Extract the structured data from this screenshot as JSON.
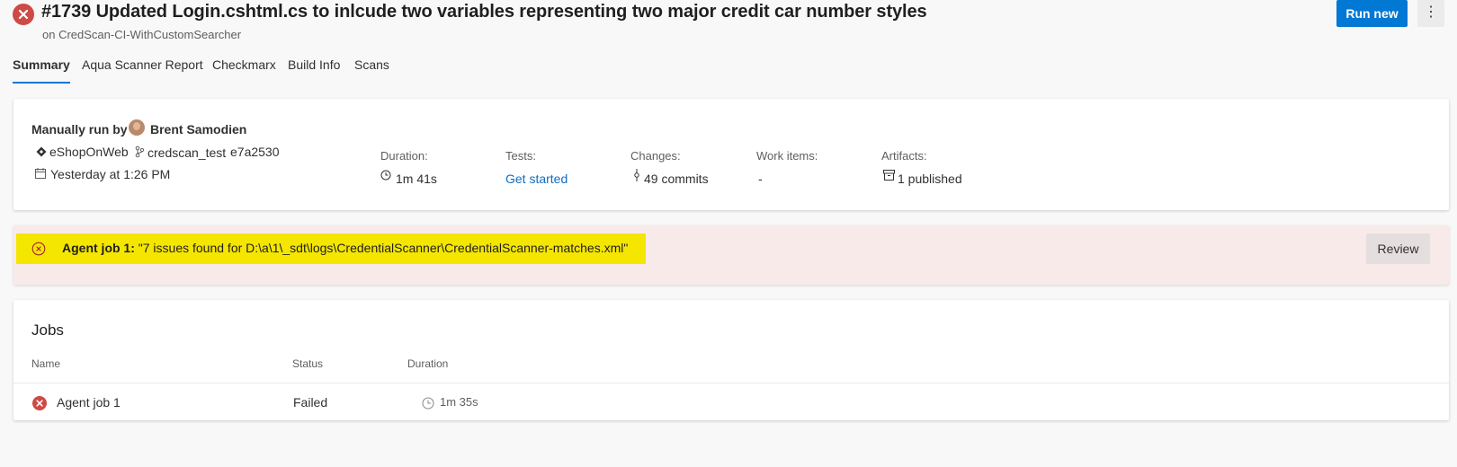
{
  "header": {
    "title": "#1739 Updated Login.cshtml.cs to inlcude two variables representing two major credit car number styles",
    "subtitle": "on CredScan-CI-WithCustomSearcher",
    "run_new_label": "Run new",
    "more_label": "⋮",
    "status_color": "#cd4a45"
  },
  "tabs": [
    {
      "label": "Summary",
      "active": true
    },
    {
      "label": "Aqua Scanner Report",
      "active": false
    },
    {
      "label": "Checkmarx",
      "active": false
    },
    {
      "label": "Build Info",
      "active": false
    },
    {
      "label": "Scans",
      "active": false
    }
  ],
  "summary": {
    "run_by_label": "Manually run by",
    "runner_name": "Brent Samodien",
    "repo": "eShopOnWeb",
    "branch": "credscan_test",
    "commit": "e7a2530",
    "date": "Yesterday at 1:26 PM",
    "duration_label": "Duration:",
    "duration_value": "1m 41s",
    "tests_label": "Tests:",
    "tests_value": "Get started",
    "changes_label": "Changes:",
    "changes_value": "49 commits",
    "work_items_label": "Work items:",
    "work_items_value": "-",
    "artifacts_label": "Artifacts:",
    "artifacts_value": "1 published"
  },
  "issue": {
    "job_label": "Agent job 1:",
    "message": "\"7 issues found for D:\\a\\1\\_sdt\\logs\\CredentialScanner\\CredentialScanner-matches.xml\"",
    "review_label": "Review",
    "highlight_color": "#f5e600"
  },
  "jobs": {
    "title": "Jobs",
    "columns": [
      "Name",
      "Status",
      "Duration"
    ],
    "rows": [
      {
        "name": "Agent job 1",
        "status": "Failed",
        "duration": "1m 35s"
      }
    ]
  },
  "accent_color": "#0078d4"
}
